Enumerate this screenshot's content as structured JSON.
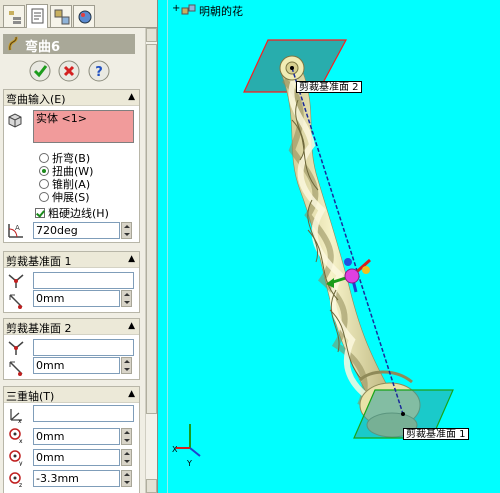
{
  "feature": {
    "title": "弯曲6",
    "confirm_label": "OK",
    "cancel_label": "Cancel",
    "help_label": "?"
  },
  "bend_input": {
    "title": "弯曲输入(E)",
    "body": "实体 <1>",
    "options": [
      "折弯(B)",
      "扭曲(W)",
      "锥削(A)",
      "伸展(S)"
    ],
    "selected_option": "扭曲(W)",
    "hard_edges_label": "粗硬边线(H)",
    "hard_edges_checked": true,
    "angle_value": "720deg"
  },
  "trim_plane_1": {
    "title": "剪裁基准面 1",
    "distance_value": "0mm"
  },
  "trim_plane_2": {
    "title": "剪裁基准面 2",
    "distance_value": "0mm"
  },
  "triad": {
    "title": "三重轴(T)",
    "x_value": "0mm",
    "y_value": "0mm",
    "z_value": "-3.3mm"
  },
  "viewport": {
    "tree_label": "明朝的花",
    "plane_label_top": "剪裁基准面 2",
    "plane_label_bottom": "剪裁基准面 1",
    "axis_x": "X",
    "axis_y": "Y",
    "background": "#00ffff"
  },
  "colors": {
    "body_fill": "#f3eebb",
    "body_shadow": "#c9c289",
    "plane_fill": "#2f9f9f",
    "plane_edge_top": "#ff1a1a",
    "plane_edge_bottom": "#19a319",
    "field_selected": "#f19b9b"
  }
}
